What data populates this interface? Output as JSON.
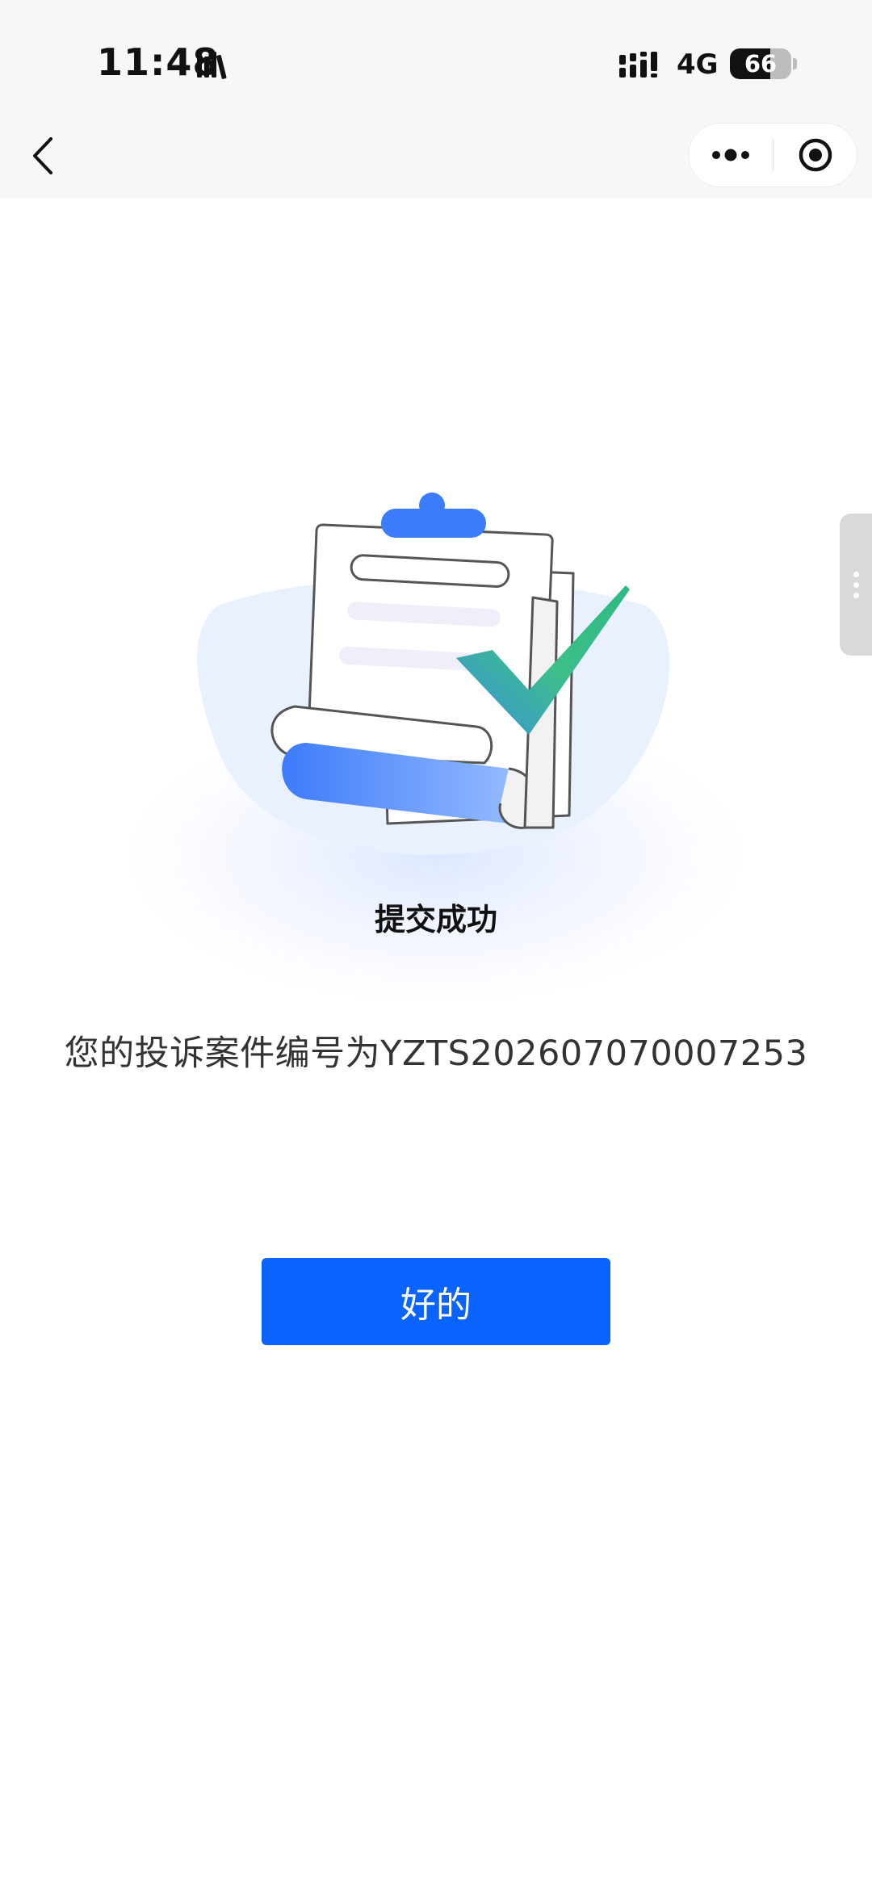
{
  "status_bar": {
    "time": "11:48",
    "network": "4G",
    "battery_level": "66",
    "battery_fraction": 0.66
  },
  "nav": {
    "back_icon": "chevron-left-icon",
    "more_icon": "more-dots-icon",
    "close_icon": "target-circle-icon"
  },
  "result": {
    "title": "提交成功",
    "case_number_text": "您的投诉案件编号为YZTS202607070007253",
    "ok_label": "好的"
  },
  "colors": {
    "primary": "#0B63FD",
    "check_green": "#3DBE8B",
    "illustration_blue": "#3C7BFA"
  }
}
